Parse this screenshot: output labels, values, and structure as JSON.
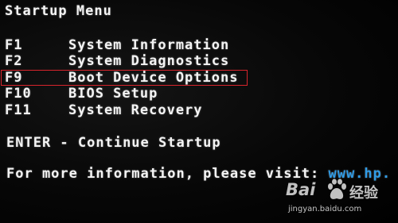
{
  "menu": {
    "title": "Startup Menu",
    "items": [
      {
        "key": "F1",
        "label": "System Information"
      },
      {
        "key": "F2",
        "label": "System Diagnostics"
      },
      {
        "key": "F9",
        "label": "Boot Device Options"
      },
      {
        "key": "F10",
        "label": "BIOS Setup"
      },
      {
        "key": "F11",
        "label": "System Recovery"
      }
    ],
    "highlighted_item": "F9",
    "enter_key": "ENTER",
    "enter_text": " - Continue Startup",
    "info_text": "For more information, please visit: ",
    "info_url": "www.hp."
  },
  "colors": {
    "background": "#000000",
    "text": "#f4f4f4",
    "url": "#2f9be6",
    "highlight_box": "#d8242c"
  },
  "watermark": {
    "logo_text": "Bai",
    "brand_text": "经验",
    "url": "jingyan.baidu.com",
    "icon": "baidu-paw-icon"
  }
}
